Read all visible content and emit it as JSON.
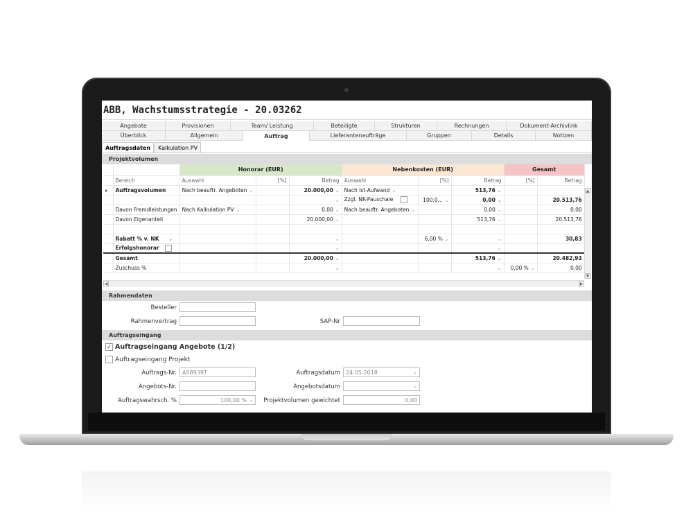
{
  "window": {
    "title": "ABB, Wachstumsstrategie - 20.03262"
  },
  "tabs_row1": [
    "Angebote",
    "Provisionen",
    "Team/ Leistung",
    "Beteiligte",
    "Strukturen",
    "Rechnungen",
    "Dokument-Archivlink"
  ],
  "tabs_row2": [
    "Überblick",
    "Allgemein",
    "Auftrag",
    "Lieferantenaufträge",
    "Gruppen",
    "Details",
    "Notizen"
  ],
  "subtabs": [
    "Auftragsdaten",
    "Kalkulation PV"
  ],
  "sections": {
    "projektvolumen": "Projektvolumen",
    "rahmendaten": "Rahmendaten",
    "auftragseingang": "Auftragseingang"
  },
  "grid": {
    "groups": {
      "honorar": "Honorar (EUR)",
      "nebenkosten": "Nebenkosten (EUR)",
      "gesamt": "Gesamt"
    },
    "headers": [
      "Bereich",
      "Auswahl",
      "[%]",
      "Betrag",
      "Auswahl",
      "[%]",
      "Betrag",
      "[%]",
      "Betrag"
    ],
    "rows": [
      [
        "Auftragsvolumen",
        "Nach beauftr. Angeboten",
        "",
        "20.000,00",
        "Nach Ist-Aufwand",
        "",
        "513,76",
        "",
        ""
      ],
      [
        "",
        "",
        "",
        "",
        "Zzgl. NK-Pauschale",
        "100,0...",
        "0,00",
        "",
        "20.513,76"
      ],
      [
        "Davon Fremdleistungen",
        "Nach Kalkulation PV",
        "",
        "0,00",
        "Nach beauftr. Angeboten",
        "",
        "0,00",
        "",
        "0,00"
      ],
      [
        "Davon Eigenanteil",
        "",
        "",
        "20.000,00",
        "",
        "",
        "513,76",
        "",
        "20.513,76"
      ],
      [
        "",
        "",
        "",
        "",
        "",
        "",
        "",
        "",
        ""
      ],
      [
        "Rabatt % v. NK",
        "",
        "",
        "",
        "",
        "6,00 %",
        "",
        "",
        "30,83"
      ],
      [
        "Erfolgshonorar",
        "",
        "",
        "",
        "",
        "",
        "",
        "",
        ""
      ],
      [
        "Gesamt",
        "",
        "",
        "20.000,00",
        "",
        "",
        "513,76",
        "",
        "20.482,93"
      ],
      [
        "Zuschuss %",
        "",
        "",
        "",
        "",
        "",
        "",
        "0,00 %",
        "0,00"
      ]
    ]
  },
  "rahmendaten": {
    "besteller_label": "Besteller",
    "besteller_value": "",
    "rahmenvertrag_label": "Rahmenvertrag",
    "rahmenvertrag_value": "",
    "sap_label": "SAP-Nr",
    "sap_value": ""
  },
  "auftragseingang": {
    "angebote_label": "Auftragseingang Angebote (1/2)",
    "angebote_checked": true,
    "projekt_label": "Auftragseingang Projekt",
    "projekt_checked": false,
    "auftragsnr_label": "Auftrags-Nr.",
    "auftragsnr_value": "A58939T",
    "auftragsdatum_label": "Auftragsdatum",
    "auftragsdatum_value": "24.05.2018",
    "angebotsnr_label": "Angebots-Nr.",
    "angebotsnr_value": "",
    "angebotsdatum_label": "Angebotsdatum",
    "angebotsdatum_value": "",
    "wahrsch_label": "Auftragswahrsch. %",
    "wahrsch_value": "100,00 %",
    "gewichtet_label": "Projektvolumen gewichtet",
    "gewichtet_value": "0,00"
  },
  "glyphs": {
    "check": "✓",
    "dropdown": "⌄",
    "scroll_up": "▲",
    "scroll_down": "▼",
    "scroll_left": "◀",
    "scroll_right": "▶",
    "row_marker": "▸"
  }
}
